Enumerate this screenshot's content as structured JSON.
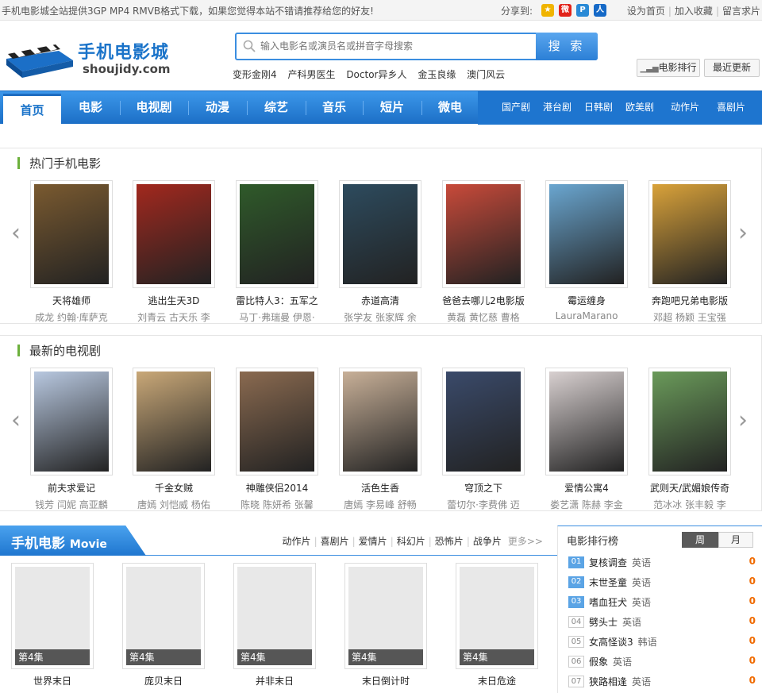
{
  "topbar": {
    "notice": "手机电影城全站提供3GP MP4 RMVB格式下载，如果您觉得本站不错请推荐给您的好友!",
    "share_label": "分享到:",
    "share_icons": [
      "qzone-icon",
      "weibo-icon",
      "pengyou-icon",
      "renren-icon"
    ],
    "links": [
      "设为首页",
      "加入收藏",
      "留言求片"
    ]
  },
  "logo": {
    "cn": "手机电影城",
    "en": "shoujidy.com"
  },
  "search": {
    "placeholder": "输入电影名或演员名或拼音字母搜索",
    "button": "搜 索"
  },
  "hotwords": [
    "变形金刚4",
    "产科男医生",
    "Doctor异乡人",
    "金玉良缘",
    "澳门风云"
  ],
  "header_buttons": {
    "ranking": "电影排行",
    "latest": "最近更新"
  },
  "nav": {
    "main": [
      "首页",
      "电影",
      "电视剧",
      "动漫",
      "综艺",
      "音乐",
      "短片",
      "微电"
    ],
    "sub": [
      "国产剧",
      "港台剧",
      "日韩剧",
      "欧美剧",
      "动作片",
      "喜剧片"
    ]
  },
  "hot_movies": {
    "title": "热门手机电影",
    "items": [
      {
        "title": "天将雄师",
        "actors": "成龙 约翰·库萨克",
        "color": "#7a5a30"
      },
      {
        "title": "逃出生天3D",
        "actors": "刘青云 古天乐 李",
        "color": "#a2281e"
      },
      {
        "title": "雷比特人3：五军之",
        "actors": "马丁·弗瑞曼 伊恩·",
        "color": "#2f5a2a"
      },
      {
        "title": "赤道高清",
        "actors": "张学友 张家辉 余",
        "color": "#2d4b5e"
      },
      {
        "title": "爸爸去哪儿2电影版",
        "actors": "黄磊 黄忆慈 曹格",
        "color": "#c84a3a"
      },
      {
        "title": "霉运缠身",
        "actors": "LauraMarano",
        "color": "#6aa6d0"
      },
      {
        "title": "奔跑吧兄弟电影版",
        "actors": "邓超 杨颖 王宝强",
        "color": "#d9a23a"
      }
    ]
  },
  "new_tv": {
    "title": "最新的电视剧",
    "items": [
      {
        "title": "前夫求爱记",
        "actors": "钱芳 闫妮 高亚麟",
        "color": "#b8c8e0"
      },
      {
        "title": "千金女贼",
        "actors": "唐嫣 刘恺威 杨佑",
        "color": "#c9a878"
      },
      {
        "title": "神雕侠侣2014",
        "actors": "陈晓 陈妍希 张馨",
        "color": "#8a6a50"
      },
      {
        "title": "活色生香",
        "actors": "唐嫣 李易峰 舒畅",
        "color": "#c8b098"
      },
      {
        "title": "穹顶之下",
        "actors": "蕾切尔·李费佛 迈",
        "color": "#3a4a6a"
      },
      {
        "title": "爱情公寓4",
        "actors": "娄艺潇 陈赫 李金",
        "color": "#d8d0d0"
      },
      {
        "title": "武则天/武媚娘传奇",
        "actors": "范冰冰 张丰毅 李",
        "color": "#6a9a5a"
      }
    ]
  },
  "movie_section": {
    "title": "手机电影",
    "title_en": "Movie",
    "cats": [
      "动作片",
      "喜剧片",
      "爱情片",
      "科幻片",
      "恐怖片",
      "战争片"
    ],
    "more": "更多>>",
    "items": [
      {
        "title": "世界末日",
        "ep": "第4集"
      },
      {
        "title": "庞贝末日",
        "ep": "第4集"
      },
      {
        "title": "并非末日",
        "ep": "第4集"
      },
      {
        "title": "末日倒计时",
        "ep": "第4集"
      },
      {
        "title": "末日危途",
        "ep": "第4集"
      }
    ]
  },
  "ranking": {
    "title": "电影排行榜",
    "tab_week": "周",
    "tab_month": "月",
    "items": [
      {
        "num": "01",
        "name": "复核调查",
        "lang": "英语",
        "count": "0"
      },
      {
        "num": "02",
        "name": "末世圣童",
        "lang": "英语",
        "count": "0"
      },
      {
        "num": "03",
        "name": "嗜血狂犬",
        "lang": "英语",
        "count": "0"
      },
      {
        "num": "04",
        "name": "劈头士",
        "lang": "英语",
        "count": "0"
      },
      {
        "num": "05",
        "name": "女高怪谈3",
        "lang": "韩语",
        "count": "0"
      },
      {
        "num": "06",
        "name": "假象",
        "lang": "英语",
        "count": "0"
      },
      {
        "num": "07",
        "name": "狭路相逢",
        "lang": "英语",
        "count": "0"
      }
    ]
  }
}
